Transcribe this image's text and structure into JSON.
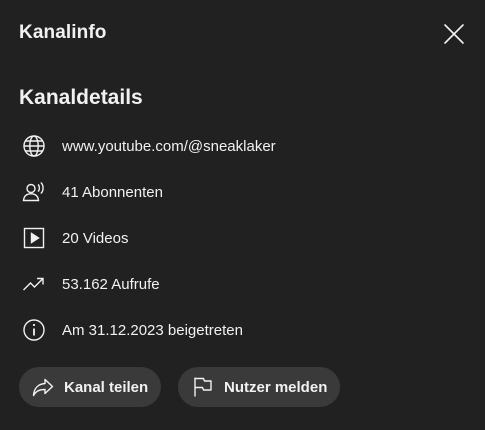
{
  "header": {
    "title": "Kanalinfo",
    "close_icon": "close-icon"
  },
  "details": {
    "title": "Kanaldetails",
    "rows": [
      {
        "icon": "globe-icon",
        "text": "www.youtube.com/@sneaklaker"
      },
      {
        "icon": "subscribers-icon",
        "text": "41 Abonnenten"
      },
      {
        "icon": "video-icon",
        "text": "20 Videos"
      },
      {
        "icon": "trending-icon",
        "text": "53.162 Aufrufe"
      },
      {
        "icon": "info-icon",
        "text": "Am 31.12.2023 beigetreten"
      }
    ]
  },
  "actions": {
    "share_label": "Kanal teilen",
    "share_icon": "share-icon",
    "report_label": "Nutzer melden",
    "report_icon": "flag-icon"
  },
  "colors": {
    "background": "#212121",
    "text": "#f1f1f1",
    "pill": "#3a3a3a"
  }
}
